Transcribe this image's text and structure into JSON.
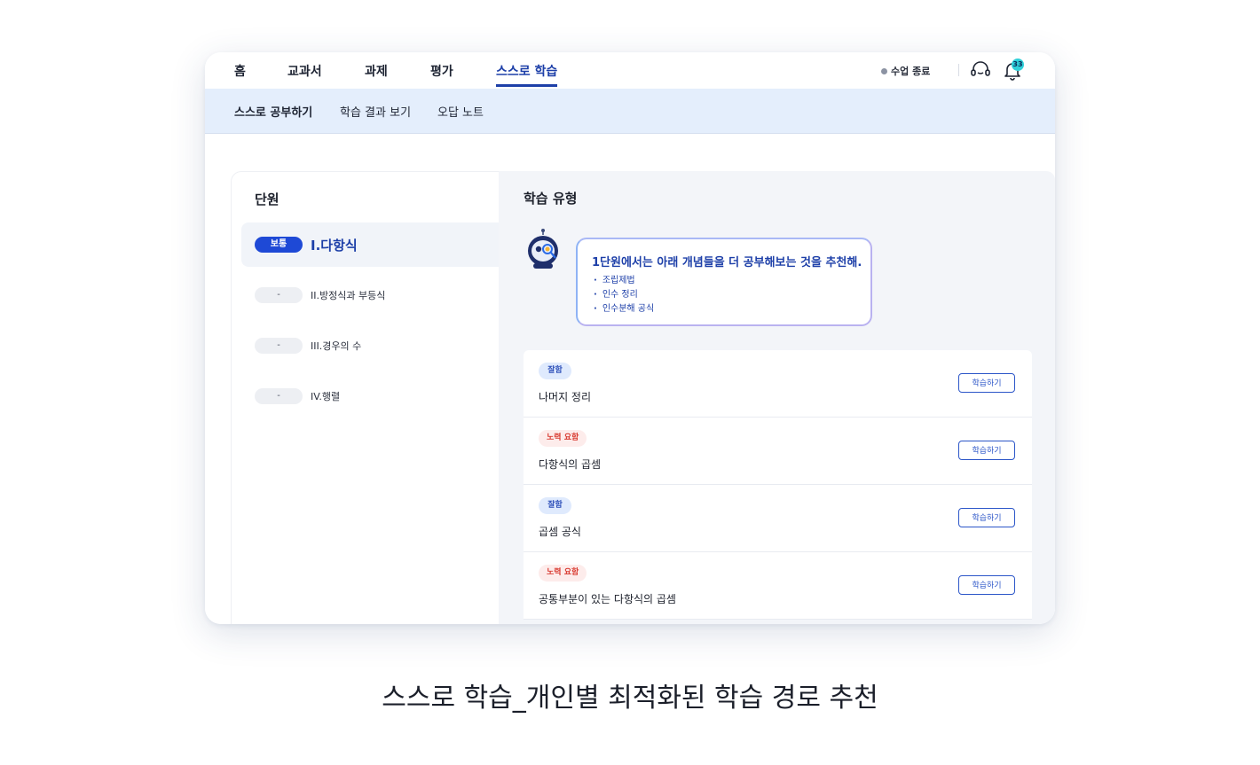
{
  "top_nav": {
    "tabs": [
      {
        "label": "홈",
        "active": false
      },
      {
        "label": "교과서",
        "active": false
      },
      {
        "label": "과제",
        "active": false
      },
      {
        "label": "평가",
        "active": false
      },
      {
        "label": "스스로 학습",
        "active": true
      }
    ],
    "end_class_label": "수업 종료",
    "headset_icon": "headset-icon",
    "bell_icon": "bell-icon",
    "notification_count": "33"
  },
  "sub_nav": {
    "items": [
      {
        "label": "스스로 공부하기",
        "active": true
      },
      {
        "label": "학습 결과 보기",
        "active": false
      },
      {
        "label": "오답 노트",
        "active": false
      }
    ]
  },
  "units": {
    "title": "단원",
    "items": [
      {
        "level": "보통",
        "name": "I.다항식",
        "selected": true
      },
      {
        "level": "-",
        "name": "II.방정식과 부등식",
        "selected": false
      },
      {
        "level": "-",
        "name": "III.경우의 수",
        "selected": false
      },
      {
        "level": "-",
        "name": "IV.행렬",
        "selected": false
      }
    ]
  },
  "study_types": {
    "title": "학습 유형",
    "recommendation": {
      "title": "1단원에서는 아래 개념들을 더 공부해보는 것을 추천해.",
      "concepts": [
        "조립제법",
        "인수 정리",
        "인수분해 공식"
      ]
    },
    "items": [
      {
        "badge": "잘함",
        "badge_type": "good",
        "title": "나머지 정리",
        "button": "학습하기"
      },
      {
        "badge": "노력 요함",
        "badge_type": "effort",
        "title": "다항식의 곱셈",
        "button": "학습하기"
      },
      {
        "badge": "잘함",
        "badge_type": "good",
        "title": "곱셈 공식",
        "button": "학습하기"
      },
      {
        "badge": "노력 요함",
        "badge_type": "effort",
        "title": "공통부분이 있는 다항식의 곱셈",
        "button": "학습하기"
      }
    ]
  },
  "colors": {
    "accent": "#1d3fa8",
    "subnav_bg": "#e4eefc",
    "good_badge_bg": "#dfeafd",
    "effort_badge_bg": "#fdeceb",
    "effort_text": "#d8382e",
    "notification_badge": "#2fd0d9"
  },
  "caption": "스스로 학습_개인별 최적화된 학습 경로 추천"
}
